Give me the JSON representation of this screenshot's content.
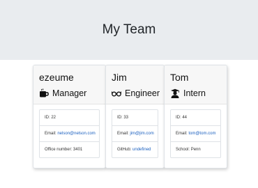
{
  "header": {
    "title": "My Team"
  },
  "team": [
    {
      "name": "ezeume",
      "role": "Manager",
      "role_icon": "coffee-mug-icon",
      "id_label": "ID:",
      "id": "22",
      "email_label": "Email:",
      "email": "nelson@nelson.com",
      "extra_label": "Office number:",
      "extra": "3401"
    },
    {
      "name": "Jim",
      "role": "Engineer",
      "role_icon": "glasses-icon",
      "id_label": "ID:",
      "id": "33",
      "email_label": "Email:",
      "email": "jim@jim.com",
      "extra_label": "GitHub:",
      "extra": "undefined"
    },
    {
      "name": "Tom",
      "role": "Intern",
      "role_icon": "graduate-icon",
      "id_label": "ID:",
      "id": "44",
      "email_label": "Email:",
      "email": "tom@tom.com",
      "extra_label": "School:",
      "extra": "Penn"
    }
  ],
  "colors": {
    "header_bg": "#e9ecef",
    "link": "#1a5fbf",
    "card_head_bg": "#f7f7f7"
  }
}
